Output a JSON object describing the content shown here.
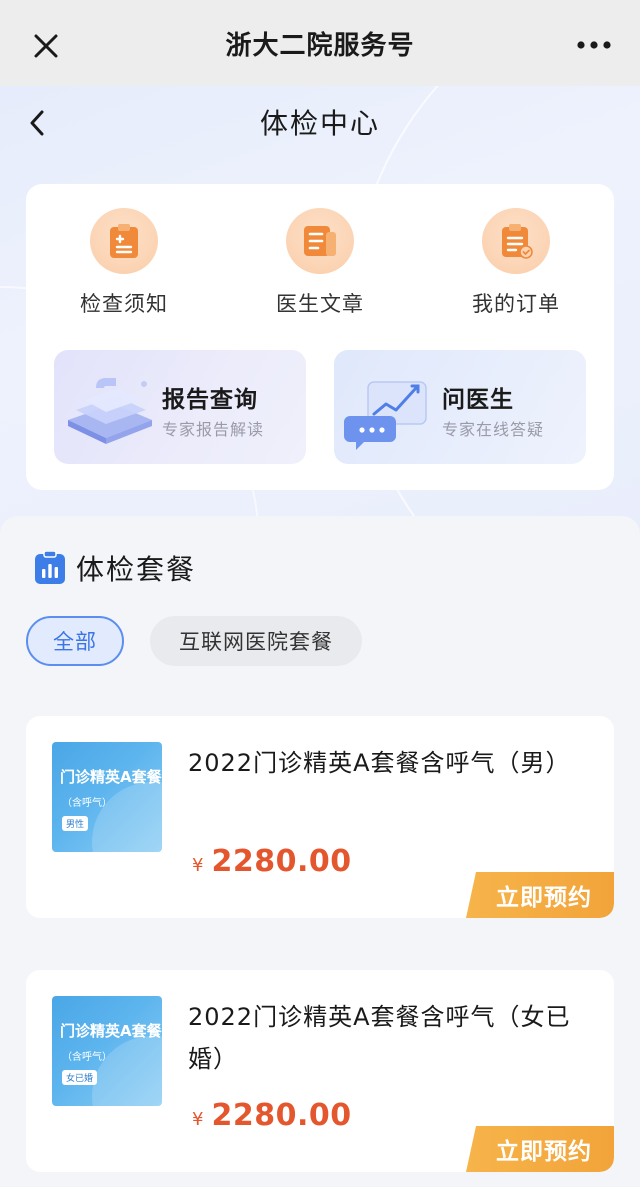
{
  "topbar": {
    "title": "浙大二院服务号"
  },
  "navbar": {
    "title": "体检中心"
  },
  "quick_entries": [
    {
      "label": "检查须知",
      "icon": "clipboard-plus-icon"
    },
    {
      "label": "医生文章",
      "icon": "document-icon"
    },
    {
      "label": "我的订单",
      "icon": "order-check-icon"
    }
  ],
  "tiles": [
    {
      "title": "报告查询",
      "subtitle": "专家报告解读"
    },
    {
      "title": "问医生",
      "subtitle": "专家在线答疑"
    }
  ],
  "section": {
    "title": "体检套餐"
  },
  "filters": [
    {
      "label": "全部",
      "selected": true
    },
    {
      "label": "互联网医院套餐",
      "selected": false
    }
  ],
  "packages": [
    {
      "name": "2022门诊精英A套餐含呼气（男）",
      "thumb_title": "门诊精英A套餐",
      "thumb_sub": "（含呼气）",
      "thumb_tag": "男性",
      "currency": "¥",
      "price": "2280.00",
      "book_label": "立即预约"
    },
    {
      "name": "2022门诊精英A套餐含呼气（女已婚）",
      "thumb_title": "门诊精英A套餐",
      "thumb_sub": "（含呼气）",
      "thumb_tag": "女已婚",
      "currency": "¥",
      "price": "2280.00",
      "book_label": "立即预约"
    }
  ],
  "colors": {
    "accent": "#3b74e6",
    "price": "#e4572e",
    "book_button": "#f4ad42",
    "icon_orange": "#f08a3a"
  }
}
